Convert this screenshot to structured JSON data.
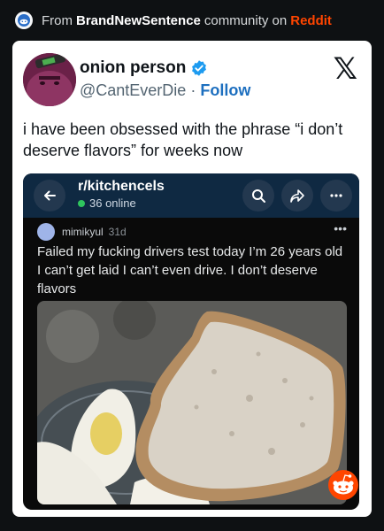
{
  "header": {
    "prefix": "From",
    "community": "BrandNewSentence",
    "middle": "community on",
    "platform": "Reddit"
  },
  "tweet": {
    "display_name": "onion person",
    "handle": "@CantEverDie",
    "separator": "·",
    "follow_label": "Follow",
    "text": "i have been obsessed with the phrase “i don’t deserve flavors” for weeks now"
  },
  "embed": {
    "subreddit": "r/kitchencels",
    "online": "36 online",
    "username": "mimikyul",
    "age": "31d",
    "more": "•••",
    "post_text": "Failed my fucking drivers test today I’m 26 years old I can’t get laid I can’t even drive. I don’t deserve flavors"
  },
  "icons": {
    "header": "reddit-community-icon",
    "verified": "verified-badge-icon",
    "platform": "x-logo-icon",
    "back": "back-arrow-icon",
    "search": "search-icon",
    "share": "share-icon",
    "more": "more-options-icon",
    "corner": "reddit-snoo-icon"
  },
  "colors": {
    "reddit_orange": "#ff4500",
    "follow_blue": "#1d6fbf",
    "verified_blue": "#1d9bf0",
    "embed_bar": "#0f2942"
  }
}
